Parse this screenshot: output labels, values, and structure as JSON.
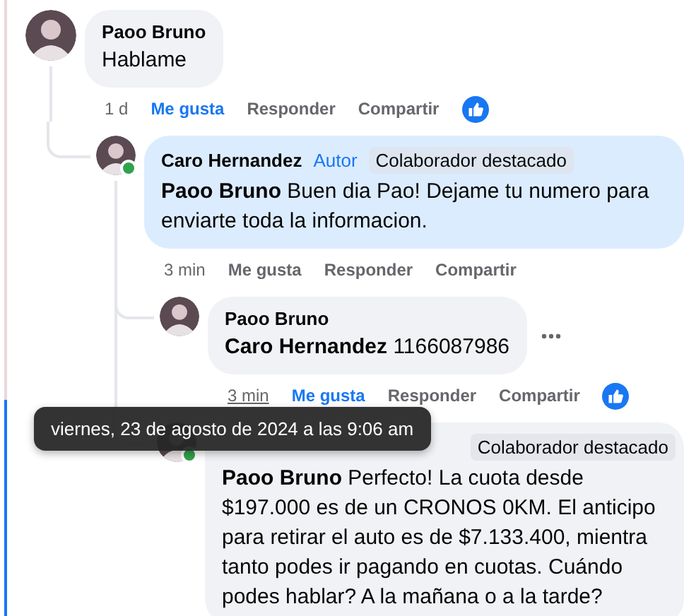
{
  "comments": [
    {
      "author": "Paoo Bruno",
      "online": false,
      "highlighted": false,
      "menu": false,
      "text": "Hablame",
      "actions": {
        "time": "1 d",
        "time_hovered": false,
        "like": "Me gusta",
        "liked": true,
        "reply": "Responder",
        "share": "Compartir",
        "reacted": true
      },
      "children": [
        {
          "author": "Caro Hernandez",
          "online": true,
          "highlighted": true,
          "menu": false,
          "author_tag": "Autor",
          "badge": "Colaborador destacado",
          "text": "**Paoo Bruno** Buen dia Pao! Dejame tu numero para enviarte toda la informacion.",
          "actions": {
            "time": "3 min",
            "time_hovered": false,
            "like": "Me gusta",
            "liked": false,
            "reply": "Responder",
            "share": "Compartir",
            "reacted": false
          },
          "children": [
            {
              "author": "Paoo Bruno",
              "online": false,
              "highlighted": false,
              "menu": true,
              "text": "**Caro Hernandez** 1166087986",
              "actions": {
                "time": "3 min",
                "time_hovered": true,
                "like": "Me gusta",
                "liked": true,
                "reply": "Responder",
                "share": "Compartir",
                "reacted": true
              }
            },
            {
              "online": true,
              "highlighted": false,
              "menu": false,
              "badge": "Colaborador destacado",
              "text": "**Paoo Bruno** Perfecto! La cuota desde $197.000 es de un CRONOS 0KM. El anticipo para retirar el auto es de $7.133.400, mientra tanto podes ir pagando en cuotas. Cuándo podes hablar? A la mañana o a la tarde?"
            }
          ]
        }
      ]
    }
  ],
  "tooltip": {
    "text": "viernes, 23 de agosto de 2024 a las 9:06 am"
  }
}
